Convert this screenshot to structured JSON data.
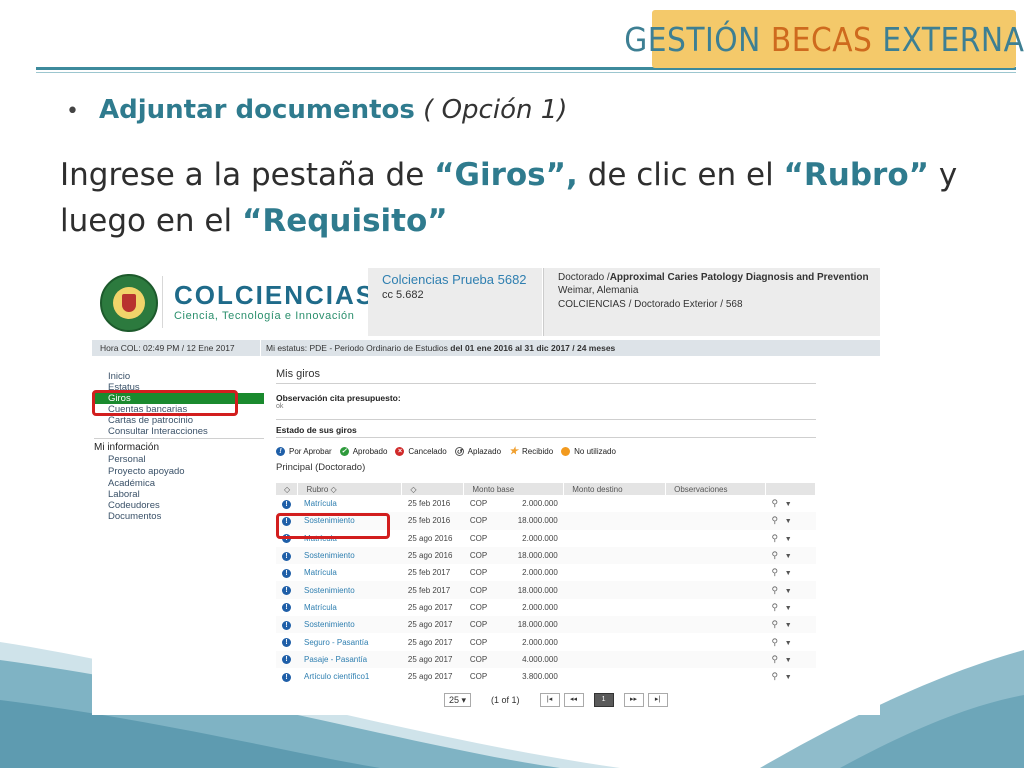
{
  "slide": {
    "brand": {
      "w1": "GESTIÓN",
      "w2": "BECAS",
      "w3": "EXTERNAS"
    },
    "bullet": {
      "dot": "•",
      "bold": "Adjuntar documentos",
      "italic": "( Opción 1)"
    },
    "instruction": {
      "p1": "Ingrese a la pestaña de ",
      "h1": "“Giros”,",
      "p2": " de clic en el ",
      "h2": "“Rubro”",
      "p3": " y luego en el ",
      "h3": "“Requisito”"
    }
  },
  "portal": {
    "logo": {
      "main": "COLCIENCIAS",
      "sub": "Ciencia, Tecnología e Innovación"
    },
    "user": {
      "name": "Colciencias Prueba 5682",
      "cc": "cc 5.682"
    },
    "program": {
      "l1a": "Doctorado /",
      "l1b": "Approximal Caries Patology Diagnosis and Prevention",
      "l2": "Weimar, Alemania",
      "l3": "COLCIENCIAS / Doctorado Exterior / 568"
    },
    "status": {
      "hora": "Hora COL: 02:49 PM / 12 Ene 2017",
      "mi_label": "Mi estatus:",
      "mi_a": "PDE - Periodo Ordinario de Estudios",
      "del": "del",
      "date1": "01 ene 2016",
      "al": "al",
      "date2": "31 dic 2017 / 24 meses"
    },
    "sidebar": {
      "items": [
        "Inicio",
        "Estatus",
        "Giros",
        "Cuentas bancarias",
        "Cartas de patrocinio",
        "Consultar Interacciones"
      ],
      "section": "Mi información",
      "info_items": [
        "Personal",
        "Proyecto apoyado",
        "Académica",
        "Laboral",
        "Codeudores",
        "Documentos"
      ]
    },
    "main": {
      "title": "Mis giros",
      "obs_label": "Observación cita presupuesto:",
      "obs_value": "ok",
      "estado": "Estado de sus giros",
      "legend": [
        "Por Aprobar",
        "Aprobado",
        "Cancelado",
        "Aplazado",
        "Recibido",
        "No utilizado"
      ],
      "principal": "Principal (Doctorado)",
      "headers": [
        "◇",
        "Rubro ◇",
        "◇",
        "Monto base",
        "Monto destino",
        "Observaciones",
        ""
      ],
      "rows": [
        {
          "rubro": "Matrícula",
          "fecha": "25 feb 2016",
          "moneda": "COP",
          "monto": "2.000.000"
        },
        {
          "rubro": "Sostenimiento",
          "fecha": "25 feb 2016",
          "moneda": "COP",
          "monto": "18.000.000"
        },
        {
          "rubro": "Matrícula",
          "fecha": "25 ago 2016",
          "moneda": "COP",
          "monto": "2.000.000"
        },
        {
          "rubro": "Sostenimiento",
          "fecha": "25 ago 2016",
          "moneda": "COP",
          "monto": "18.000.000"
        },
        {
          "rubro": "Matrícula",
          "fecha": "25 feb 2017",
          "moneda": "COP",
          "monto": "2.000.000"
        },
        {
          "rubro": "Sostenimiento",
          "fecha": "25 feb 2017",
          "moneda": "COP",
          "monto": "18.000.000"
        },
        {
          "rubro": "Matrícula",
          "fecha": "25 ago 2017",
          "moneda": "COP",
          "monto": "2.000.000"
        },
        {
          "rubro": "Sostenimiento",
          "fecha": "25 ago 2017",
          "moneda": "COP",
          "monto": "18.000.000"
        },
        {
          "rubro": "Seguro - Pasantía",
          "fecha": "25 ago 2017",
          "moneda": "COP",
          "monto": "2.000.000"
        },
        {
          "rubro": "Pasaje - Pasantía",
          "fecha": "25 ago 2017",
          "moneda": "COP",
          "monto": "4.000.000"
        },
        {
          "rubro": "Artículo científico1",
          "fecha": "25 ago 2017",
          "moneda": "COP",
          "monto": "3.800.000"
        }
      ]
    },
    "pager": {
      "page_size": "25 ▾",
      "info": "(1 of 1)",
      "first": "|◂",
      "prev": "◂◂",
      "current": "1",
      "next": "▸▸",
      "last": "▸|"
    }
  }
}
